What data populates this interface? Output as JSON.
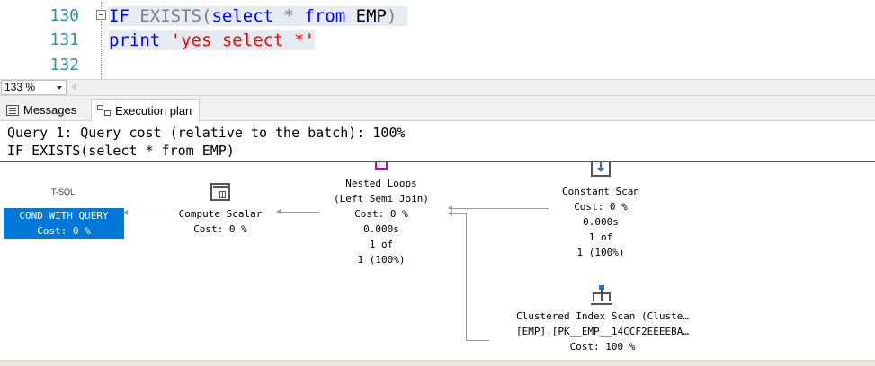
{
  "editor": {
    "line_numbers": [
      "130",
      "131",
      "132"
    ],
    "line1": {
      "kw1": "IF",
      "fn1": "EXISTS",
      "p1": "(",
      "kw2": "select",
      "star": "*",
      "kw3": "from",
      "tbl": "EMP",
      "p2": ")"
    },
    "line2": {
      "kw": "print",
      "str": "'yes select *'"
    }
  },
  "zoom": {
    "value": "133 %"
  },
  "tabs": [
    {
      "label": "Messages"
    },
    {
      "label": "Execution plan"
    }
  ],
  "plan": {
    "header_line1": "Query 1: Query cost (relative to the batch): 100%",
    "header_line2": "IF EXISTS(select * from EMP)",
    "tsql_label": "T-SQL",
    "nodes": {
      "cond": {
        "line1": "COND WITH QUERY",
        "line2": "Cost: 0 %"
      },
      "compute": {
        "line1": "Compute Scalar",
        "line2": "Cost: 0 %"
      },
      "nested": {
        "line1": "Nested Loops",
        "line2": "(Left Semi Join)",
        "line3": "Cost: 0 %",
        "line4": "0.000s",
        "line5": "1 of",
        "line6": "1 (100%)"
      },
      "constant": {
        "line1": "Constant Scan",
        "line2": "Cost: 0 %",
        "line3": "0.000s",
        "line4": "1 of",
        "line5": "1 (100%)"
      },
      "cis": {
        "line1": "Clustered Index Scan (Cluste…",
        "line2": "[EMP].[PK__EMP__14CCF2EEEEBA…",
        "line3": "Cost: 100 %"
      }
    }
  }
}
